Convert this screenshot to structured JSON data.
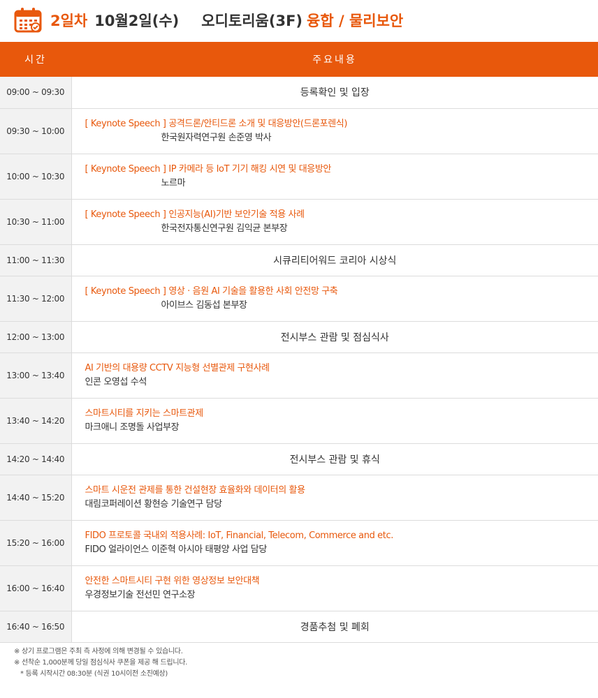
{
  "header": {
    "day": "2일차",
    "date": "10월2일(수)",
    "place": "오디토리움(3F)",
    "topic": "융합 / 물리보안",
    "icon": "calendar-icon",
    "accent_color": "#e8580c"
  },
  "table": {
    "col_time": "시간",
    "col_content": "주요내용",
    "rows": [
      {
        "time": "09:00 ~ 09:30",
        "text": "등록확인 및 입장"
      },
      {
        "time": "09:30 ~ 10:00",
        "title": "[ Keynote Speech ] 공격드론/안티드론 소개 및 대응방안(드론포렌식)",
        "speaker": "한국원자력연구원 손준영 박사"
      },
      {
        "time": "10:00 ~ 10:30",
        "title": "[ Keynote Speech ] IP 카메라 등 IoT 기기 해킹 시연 및 대응방안",
        "speaker": "노르마"
      },
      {
        "time": "10:30 ~ 11:00",
        "title": "[ Keynote Speech ]  인공지능(AI)기반 보안기술 적용 사례",
        "speaker": "한국전자통신연구원 김익균 본부장"
      },
      {
        "time": "11:00 ~ 11:30",
        "text": "시큐리티어워드 코리아 시상식"
      },
      {
        "time": "11:30 ~ 12:00",
        "title": "[ Keynote Speech ] 영상 · 음원 AI 기술을 활용한 사회 안전망 구축",
        "speaker": "아이브스 김동섭 본부장"
      },
      {
        "time": "12:00 ~ 13:00",
        "text": "전시부스 관람 및 점심식사"
      },
      {
        "time": "13:00 ~ 13:40",
        "title": "AI 기반의 대용량 CCTV 지능형 선별관제 구현사례",
        "speaker": "인콘 오영섭 수석"
      },
      {
        "time": "13:40 ~ 14:20",
        "title": "스마트시티를 지키는 스마트관제",
        "speaker": "마크애니 조명돌 사업부장"
      },
      {
        "time": "14:20 ~ 14:40",
        "text": "전시부스 관람 및 휴식"
      },
      {
        "time": "14:40 ~ 15:20",
        "title": "스마트 시운전 관제를 통한 건설현장 효율화와 데이터의 활용",
        "speaker": "대림코퍼레이션 황현승 기술연구 담당"
      },
      {
        "time": "15:20 ~ 16:00",
        "title": "FIDO 프로토콜 국내외 적용사례: IoT, Financial, Telecom, Commerce and etc.",
        "speaker": "FIDO 얼라이언스 이준혁 아시아 태평양 사업 담당"
      },
      {
        "time": "16:00 ~ 16:40",
        "title": "안전한 스마트시티 구현 위한 영상정보 보안대책",
        "speaker": "우경정보기술 전선민 연구소장"
      },
      {
        "time": "16:40 ~ 16:50",
        "text": "경품추첨 및 폐회"
      }
    ]
  },
  "notes": {
    "n1": "※ 상기 프로그램은 주최 측 사정에 의해 변경될 수 있습니다.",
    "n2": "※ 선착순 1,000분께 당일 점심식사 쿠폰을 제공 해 드립니다.",
    "n3": "* 등록 시작시간 08:30분 (식권 10시이전 소진예상)"
  }
}
